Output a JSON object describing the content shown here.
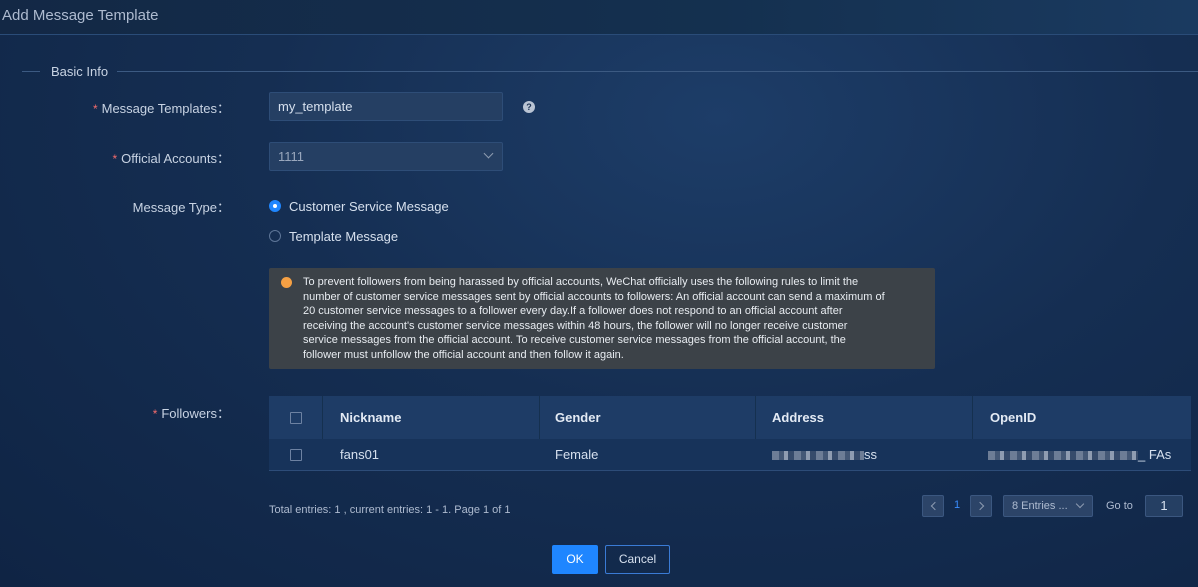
{
  "dialog": {
    "title": "Add Message Template"
  },
  "section": {
    "label": "Basic Info"
  },
  "form": {
    "message_templates": {
      "label": "Message Templates",
      "value": "my_template",
      "required": true
    },
    "official_accounts": {
      "label": "Official Accounts",
      "value": "1111",
      "required": true
    },
    "message_type": {
      "label": "Message Type",
      "options": [
        "Customer Service Message",
        "Template Message"
      ],
      "selected": "Customer Service Message"
    },
    "notice": "To prevent followers from being harassed by official accounts, WeChat officially uses the following rules to limit the number of customer service messages sent by official accounts to followers: An official account can send a maximum of 20 customer service messages to a follower every day.If a follower does not respond to an official account after receiving the account's customer service messages within 48 hours, the follower will no longer receive customer service messages from the official account. To receive customer service messages from the official account, the follower must unfollow the official account and then follow it again.",
    "followers": {
      "label": "Followers",
      "required": true
    }
  },
  "table": {
    "columns": [
      "Nickname",
      "Gender",
      "Address",
      "OpenID"
    ],
    "rows": [
      {
        "nickname": "fans01",
        "gender": "Female",
        "address_tail": "ss",
        "openid_tail": "_ FAs"
      }
    ]
  },
  "pagination": {
    "total_text": "Total entries: 1 , current entries: 1 - 1. Page 1 of 1",
    "current_page": "1",
    "page_size": "8 Entries ...",
    "goto_label": "Go to",
    "goto_value": "1"
  },
  "buttons": {
    "ok": "OK",
    "cancel": "Cancel"
  },
  "colors": {
    "accent": "#1f86ff",
    "required": "#f56c6c",
    "warning": "#f5a044"
  }
}
